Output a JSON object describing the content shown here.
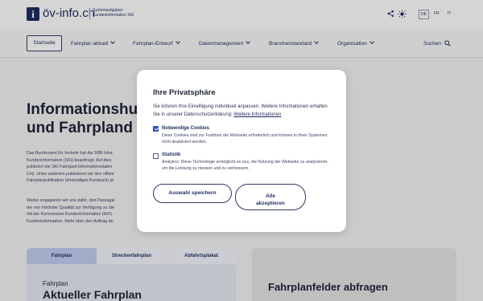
{
  "header": {
    "logo_letter": "i",
    "site_name": "öv-info.ch",
    "tagline_line1": "Systemaufgaben",
    "tagline_line2": "Kundeninformation SKI",
    "share_icon": "share-icon",
    "theme_icon": "sun-icon",
    "languages": [
      "DE",
      "FR",
      "IT"
    ],
    "active_language": "DE"
  },
  "nav": {
    "home": "Startseite",
    "items": [
      "Fahrplan aktuell",
      "Fahrplan-Entwurf",
      "Datenmanagement",
      "Branchenstandard",
      "Organisation"
    ],
    "search": "Suchen"
  },
  "hero": {
    "title_line1": "Informationshu",
    "title_line2": "und Fahrpland",
    "para1": [
      "Das Bundesamt für Verkehr hat die SBB Infra",
      "Kundeninformation (SKI) beauftragt. Auf dies",
      "publiziert die SKI Fahrgast-Informationsdaten",
      "CH). Unter anderem publizieren wir den offizie",
      "Fahrplanpublikation (ehemaliges Kursbuch) jä"
    ],
    "para2": [
      "Weiter engagieren wir uns dafür, den Passagie",
      "ten von höchster Qualität zur Verfügung zu ste",
      "mit der Kommission Kundeninformation (KKI)",
      "Kundeninformation. Mehr über den Auftrag de"
    ]
  },
  "tabs": {
    "items": [
      "Fahrplan",
      "Streckenfahrplan",
      "Abfahrtsplakat"
    ],
    "active": "Fahrplan",
    "card_subtitle": "Fahrplan",
    "card_title": "Aktueller Fahrplan"
  },
  "right_card": {
    "title": "Fahrplanfelder abfragen"
  },
  "consent": {
    "title": "Ihre Privatsphäre",
    "intro": "Sie können Ihre Einwilligung individuell anpassen. Weitere Informationen erhalten Sie in unserer Datenschutzerklärung:",
    "intro_link": "Weitere Informationen",
    "options": [
      {
        "label": "Notwendige Cookies",
        "checked": true,
        "description": "Diese Cookies sind zur Funktion der Webseite erforderlich und können in Ihren Systemen nicht deaktiviert werden."
      },
      {
        "label": "Statistik",
        "checked": false,
        "description": "Analytics: Diese Technologie ermöglicht es uns, die Nutzung der Webseite zu analysieren, um die Leistung zu messen und zu verbessern."
      }
    ],
    "save_label": "Auswahl speichern",
    "accept_label_line1": "Alle",
    "accept_label_line2": "akzeptieren"
  }
}
